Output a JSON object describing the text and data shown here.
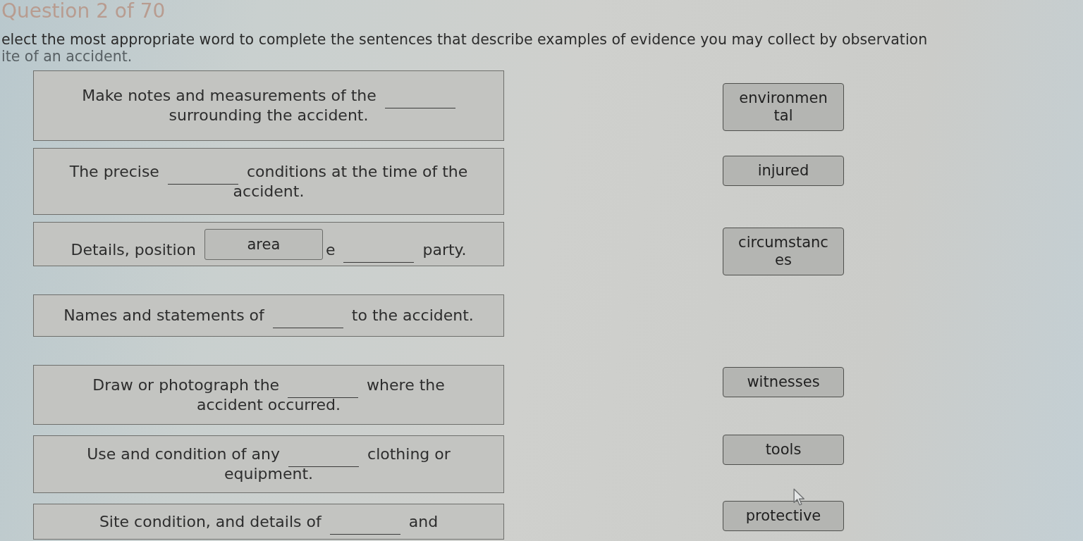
{
  "header": {
    "question_counter": "Question 2 of 70",
    "instruction_lines": [
      "elect the most appropriate word to complete the sentences that describe examples of evidence you may collect by observation",
      "ite of an accident."
    ]
  },
  "sentences": [
    {
      "lines": [
        [
          {
            "kind": "text",
            "text": "Make notes and measurements of the"
          },
          {
            "kind": "blank"
          }
        ],
        [
          {
            "kind": "text",
            "text": "surrounding the accident."
          }
        ]
      ]
    },
    {
      "lines": [
        [
          {
            "kind": "text",
            "text": "The precise"
          },
          {
            "kind": "blank"
          },
          {
            "kind": "text",
            "text": "conditions at the time of the"
          }
        ],
        [
          {
            "kind": "text",
            "text": "accident."
          }
        ]
      ]
    },
    {
      "lines": [
        [
          {
            "kind": "text",
            "text": "Details, position"
          },
          {
            "kind": "tile",
            "text": "area"
          },
          {
            "kind": "text",
            "text": "e"
          },
          {
            "kind": "blank"
          },
          {
            "kind": "text",
            "text": "party."
          }
        ]
      ]
    },
    {
      "lines": [
        [
          {
            "kind": "text",
            "text": "Names and statements of"
          },
          {
            "kind": "blank"
          },
          {
            "kind": "text",
            "text": "to the accident."
          }
        ]
      ]
    },
    {
      "lines": [
        [
          {
            "kind": "text",
            "text": "Draw or photograph the"
          },
          {
            "kind": "blank"
          },
          {
            "kind": "text",
            "text": "where the"
          }
        ],
        [
          {
            "kind": "text",
            "text": "accident occurred."
          }
        ]
      ]
    },
    {
      "lines": [
        [
          {
            "kind": "text",
            "text": "Use and condition of any"
          },
          {
            "kind": "blank"
          },
          {
            "kind": "text",
            "text": "clothing or"
          }
        ],
        [
          {
            "kind": "text",
            "text": "equipment."
          }
        ]
      ]
    },
    {
      "lines": [
        [
          {
            "kind": "text",
            "text": "Site condition, and details of"
          },
          {
            "kind": "blank"
          },
          {
            "kind": "text",
            "text": "and"
          }
        ]
      ]
    }
  ],
  "word_bank": [
    "environmental",
    "injured",
    "circumstances",
    "witnesses",
    "tools",
    "protective"
  ]
}
